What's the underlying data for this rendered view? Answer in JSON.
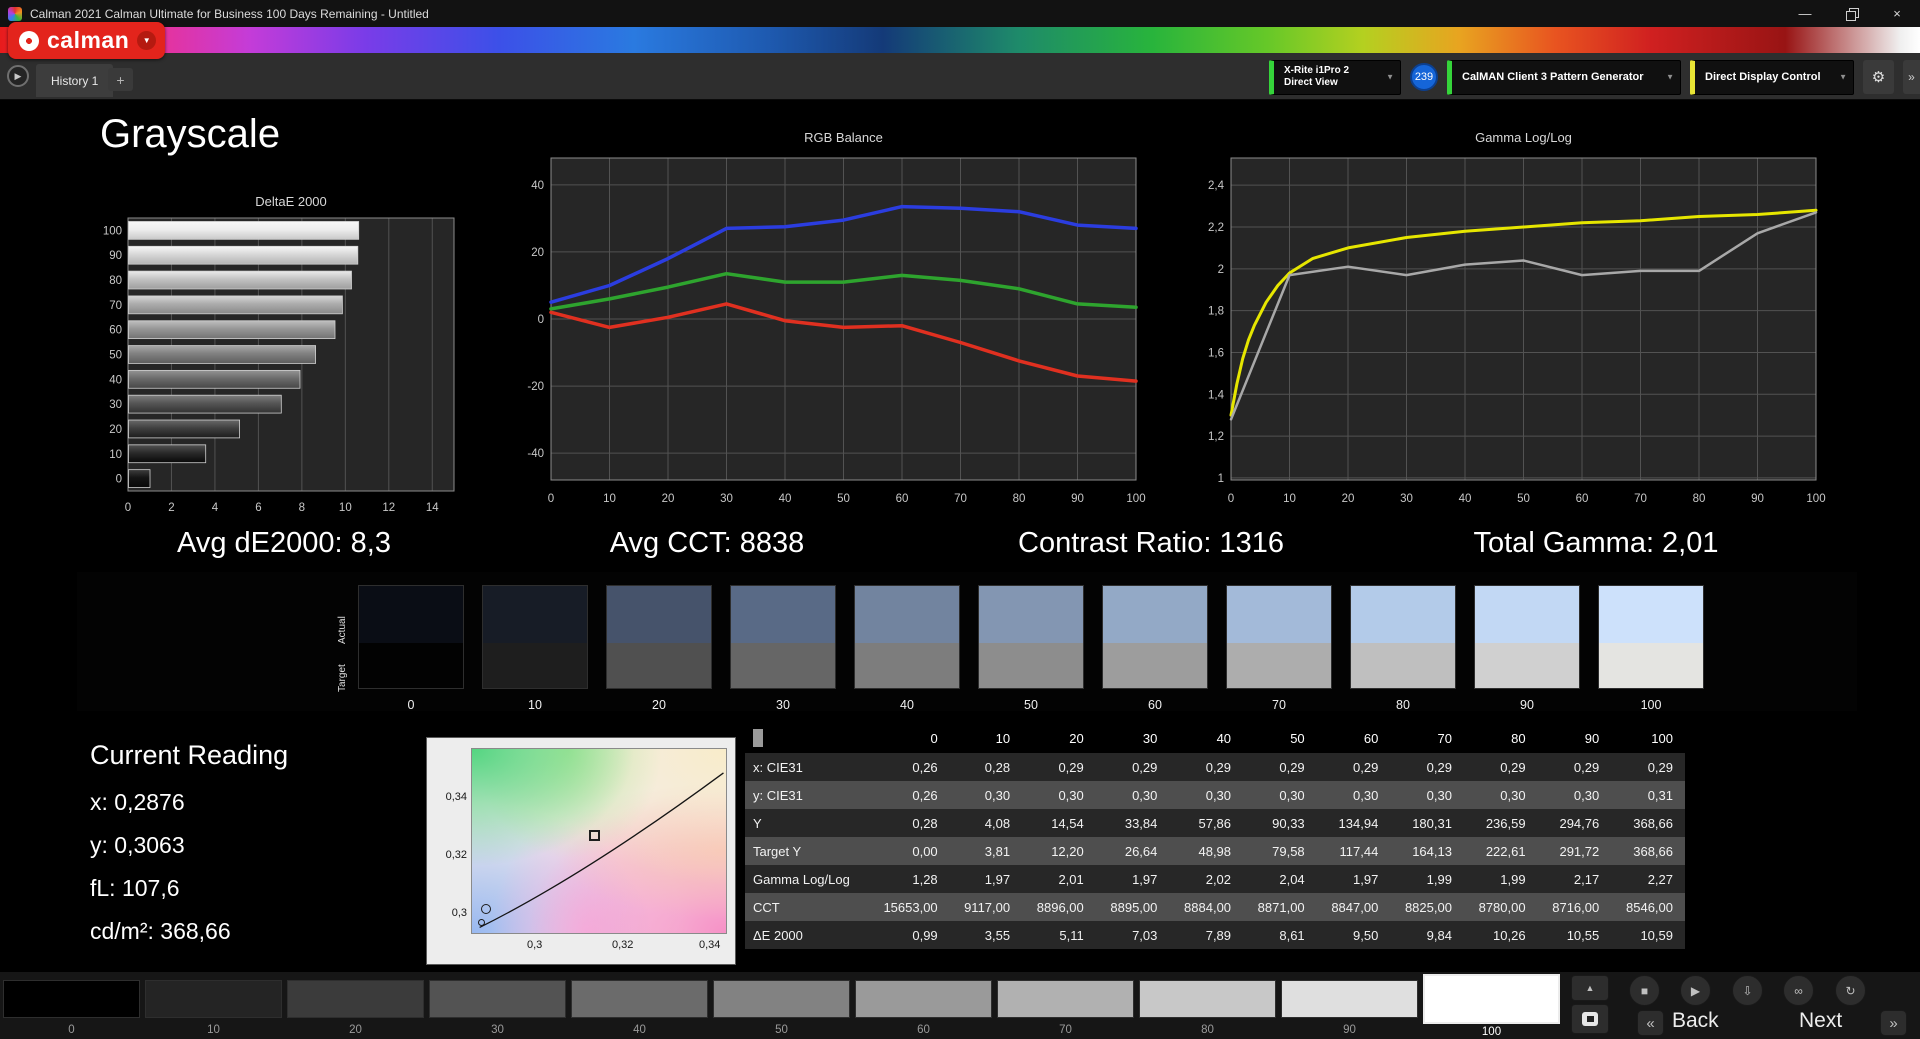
{
  "title_bar": {
    "app_title": "Calman 2021 Calman Ultimate for Business 100 Days Remaining  - Untitled"
  },
  "logo": {
    "wordmark": "calman"
  },
  "tab_bar": {
    "history_tab": "History 1",
    "add_tab_label": "+"
  },
  "toolbar": {
    "meter": {
      "line1": "X-Rite i1Pro 2",
      "line2": "Direct View"
    },
    "badge_count": "239",
    "pattern_generator": "CalMAN Client 3 Pattern Generator",
    "display_control": "Direct Display Control"
  },
  "icons": {
    "minimize": "—",
    "close": "×",
    "dropdown": "▼",
    "history_nav": "▶",
    "gear": "⚙",
    "edge": "»",
    "eject": "▲",
    "stop": "■",
    "play": "▶",
    "save": "⇩",
    "link": "∞",
    "refresh": "↻",
    "prev": "«",
    "next": "»",
    "logo_arrow": "▼"
  },
  "page": {
    "title": "Grayscale"
  },
  "stats": {
    "avg_de": "Avg dE2000: 8,3",
    "avg_cct": "Avg CCT: 8838",
    "contrast": "Contrast Ratio: 1316",
    "total_gamma": "Total Gamma: 2,01"
  },
  "chart_data": [
    {
      "id": "deltae",
      "type": "bar",
      "orientation": "horizontal",
      "title": "DeltaE 2000",
      "categories": [
        100,
        90,
        80,
        70,
        60,
        50,
        40,
        30,
        20,
        10,
        0
      ],
      "values": [
        10.59,
        10.55,
        10.26,
        9.84,
        9.5,
        8.61,
        7.89,
        7.03,
        5.11,
        3.55,
        0.99
      ],
      "xlim": [
        0,
        15
      ],
      "xticks": [
        0,
        2,
        4,
        6,
        8,
        10,
        12,
        14
      ]
    },
    {
      "id": "rgb_balance",
      "type": "line",
      "title": "RGB Balance",
      "x": [
        0,
        10,
        20,
        30,
        40,
        50,
        60,
        70,
        80,
        90,
        100
      ],
      "xlim": [
        0,
        100
      ],
      "ylim": [
        -48,
        48
      ],
      "xticks": [
        0,
        10,
        20,
        30,
        40,
        50,
        60,
        70,
        80,
        90,
        100
      ],
      "yticks": [
        40,
        20,
        0,
        -20,
        -40
      ],
      "series": [
        {
          "name": "blue",
          "color": "#2b3de0",
          "values": [
            5,
            10,
            18,
            27,
            27.5,
            29.5,
            33.5,
            33,
            32,
            28,
            27
          ]
        },
        {
          "name": "green",
          "color": "#2ea42e",
          "values": [
            3,
            6,
            9.5,
            13.5,
            11,
            11,
            13,
            11.5,
            9,
            4.5,
            3.5
          ]
        },
        {
          "name": "red",
          "color": "#e03020",
          "values": [
            2,
            -2.5,
            0.5,
            4.5,
            -0.5,
            -2.5,
            -2,
            -7,
            -12.5,
            -17,
            -18.5
          ]
        }
      ]
    },
    {
      "id": "gamma",
      "type": "line",
      "title": "Gamma Log/Log",
      "x": [
        0,
        10,
        20,
        30,
        40,
        50,
        60,
        70,
        80,
        90,
        100
      ],
      "xlim": [
        0,
        100
      ],
      "ylim": [
        0.99,
        2.53
      ],
      "xticks": [
        0,
        10,
        20,
        30,
        40,
        50,
        60,
        70,
        80,
        90,
        100
      ],
      "yticks": [
        2.4,
        2.2,
        2,
        1.8,
        1.6,
        1.4,
        1.2,
        1
      ],
      "ytick_labels": [
        "2,4",
        "2,2",
        "2",
        "1,8",
        "1,6",
        "1,4",
        "1,2",
        "1"
      ],
      "series": [
        {
          "name": "target",
          "color": "#e6e600",
          "width": 3,
          "x": [
            0,
            1,
            2,
            3,
            4,
            6,
            8,
            10,
            14,
            20,
            30,
            40,
            50,
            60,
            70,
            80,
            90,
            100
          ],
          "values": [
            1.3,
            1.45,
            1.57,
            1.66,
            1.73,
            1.84,
            1.92,
            1.98,
            2.05,
            2.1,
            2.15,
            2.18,
            2.2,
            2.22,
            2.23,
            2.25,
            2.26,
            2.28
          ]
        },
        {
          "name": "measured",
          "color": "#a8a8a8",
          "width": 2.5,
          "values": [
            1.28,
            1.97,
            2.01,
            1.97,
            2.02,
            2.04,
            1.97,
            1.99,
            1.99,
            2.17,
            2.27
          ]
        }
      ]
    }
  ],
  "swatch_strip": {
    "row_labels": {
      "actual": "Actual",
      "target": "Target"
    },
    "items": [
      {
        "level": "0",
        "actual": "#0a0d15",
        "target": "#020202"
      },
      {
        "level": "10",
        "actual": "#171c26",
        "target": "#1e1e1e"
      },
      {
        "level": "20",
        "actual": "#46536b",
        "target": "#505050"
      },
      {
        "level": "30",
        "actual": "#596a86",
        "target": "#666666"
      },
      {
        "level": "40",
        "actual": "#72849f",
        "target": "#7d7d7d"
      },
      {
        "level": "50",
        "actual": "#8396b2",
        "target": "#8d8d8d"
      },
      {
        "level": "60",
        "actual": "#93a9c6",
        "target": "#9d9d9d"
      },
      {
        "level": "70",
        "actual": "#a3bad9",
        "target": "#adadad"
      },
      {
        "level": "80",
        "actual": "#b3cbe9",
        "target": "#bfbfbf"
      },
      {
        "level": "90",
        "actual": "#c2d8f4",
        "target": "#d0d0d0"
      },
      {
        "level": "100",
        "actual": "#cde1fb",
        "target": "#e4e4e1"
      }
    ]
  },
  "current_reading": {
    "title": "Current Reading",
    "items": [
      "x: 0,2876",
      "y: 0,3063",
      "fL: 107,6",
      "cd/m²: 368,66"
    ]
  },
  "cie_chart": {
    "y_ticks": [
      "0,34",
      "0,32",
      "0,3"
    ],
    "x_ticks": [
      "0,3",
      "0,32",
      "0,34"
    ]
  },
  "table": {
    "columns": [
      "0",
      "10",
      "20",
      "30",
      "40",
      "50",
      "60",
      "70",
      "80",
      "90",
      "100"
    ],
    "rows": [
      {
        "label": "x: CIE31",
        "values": [
          "0,26",
          "0,28",
          "0,29",
          "0,29",
          "0,29",
          "0,29",
          "0,29",
          "0,29",
          "0,29",
          "0,29",
          "0,29"
        ]
      },
      {
        "label": "y: CIE31",
        "values": [
          "0,26",
          "0,30",
          "0,30",
          "0,30",
          "0,30",
          "0,30",
          "0,30",
          "0,30",
          "0,30",
          "0,30",
          "0,31"
        ]
      },
      {
        "label": "Y",
        "values": [
          "0,28",
          "4,08",
          "14,54",
          "33,84",
          "57,86",
          "90,33",
          "134,94",
          "180,31",
          "236,59",
          "294,76",
          "368,66"
        ]
      },
      {
        "label": "Target Y",
        "values": [
          "0,00",
          "3,81",
          "12,20",
          "26,64",
          "48,98",
          "79,58",
          "117,44",
          "164,13",
          "222,61",
          "291,72",
          "368,66"
        ]
      },
      {
        "label": "Gamma Log/Log",
        "values": [
          "1,28",
          "1,97",
          "2,01",
          "1,97",
          "2,02",
          "2,04",
          "1,97",
          "1,99",
          "1,99",
          "2,17",
          "2,27"
        ]
      },
      {
        "label": "CCT",
        "values": [
          "15653,00",
          "9117,00",
          "8896,00",
          "8895,00",
          "8884,00",
          "8871,00",
          "8847,00",
          "8825,00",
          "8780,00",
          "8716,00",
          "8546,00"
        ]
      },
      {
        "label": "ΔE 2000",
        "values": [
          "0,99",
          "3,55",
          "5,11",
          "7,03",
          "7,89",
          "8,61",
          "9,50",
          "9,84",
          "10,26",
          "10,55",
          "10,59"
        ]
      }
    ]
  },
  "bottom_bar": {
    "back_label": "Back",
    "next_label": "Next",
    "patches": [
      {
        "label": "0",
        "color": "#000000"
      },
      {
        "label": "10",
        "color": "#242424"
      },
      {
        "label": "20",
        "color": "#3b3b3b"
      },
      {
        "label": "30",
        "color": "#535353"
      },
      {
        "label": "40",
        "color": "#6b6b6b"
      },
      {
        "label": "50",
        "color": "#828282"
      },
      {
        "label": "60",
        "color": "#9a9a9a"
      },
      {
        "label": "70",
        "color": "#b1b1b1"
      },
      {
        "label": "80",
        "color": "#c8c8c8"
      },
      {
        "label": "90",
        "color": "#dfdfdf"
      },
      {
        "label": "100",
        "color": "#ffffff",
        "selected": true
      }
    ]
  }
}
